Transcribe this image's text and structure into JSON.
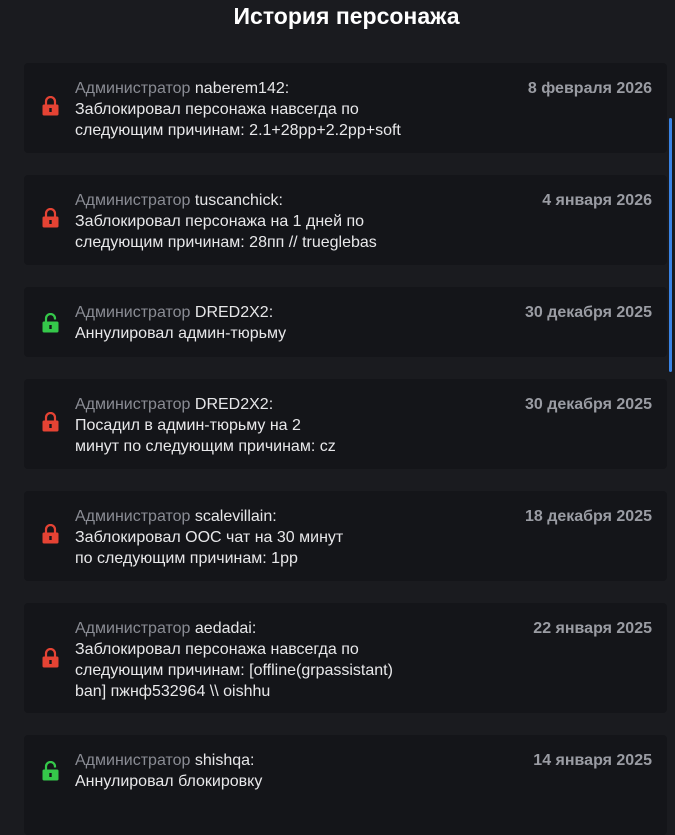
{
  "page": {
    "title": "История персонажа"
  },
  "colors": {
    "lock_closed": "#e54334",
    "lock_open": "#35c84a",
    "scrollbar": "#3a84e6"
  },
  "entries": [
    {
      "role": "Администратор",
      "admin": "naberem142:",
      "date": "8 февраля 2026",
      "icon": "lock-closed-icon",
      "action_lines": [
        "Заблокировал персонажа навсегда по",
        "следующим причинам: 2.1+28pp+2.2pp+soft"
      ]
    },
    {
      "role": "Администратор",
      "admin": "tuscanchick:",
      "date": "4 января 2026",
      "icon": "lock-closed-icon",
      "action_lines": [
        "Заблокировал персонажа на 1 дней по",
        "следующим причинам: 28пп // trueglebas"
      ]
    },
    {
      "role": "Администратор",
      "admin": "DRED2X2:",
      "date": "30 декабря 2025",
      "icon": "lock-open-icon",
      "action_lines": [
        "Аннулировал админ-тюрьму"
      ]
    },
    {
      "role": "Администратор",
      "admin": "DRED2X2:",
      "date": "30 декабря 2025",
      "icon": "lock-closed-icon",
      "action_lines": [
        "Посадил в админ-тюрьму на 2",
        "минут по следующим причинам: cz"
      ]
    },
    {
      "role": "Администратор",
      "admin": "scalevillain:",
      "date": "18 декабря 2025",
      "icon": "lock-closed-icon",
      "action_lines": [
        "Заблокировал ООС чат на 30 минут",
        "по следующим причинам: 1pp"
      ]
    },
    {
      "role": "Администратор",
      "admin": "aedadai:",
      "date": "22 января 2025",
      "icon": "lock-closed-icon",
      "action_lines": [
        "Заблокировал персонажа навсегда по",
        "следующим причинам: [offline(grpassistant)",
        "ban] пжнф532964 \\\\ oishhu"
      ]
    },
    {
      "role": "Администратор",
      "admin": "shishqa:",
      "date": "14 января 2025",
      "icon": "lock-open-icon",
      "action_lines": [
        "Аннулировал блокировку"
      ]
    }
  ]
}
